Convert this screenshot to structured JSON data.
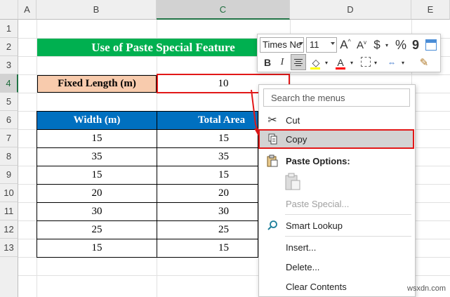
{
  "columns": [
    "A",
    "B",
    "C",
    "D",
    "E"
  ],
  "rows": [
    "1",
    "2",
    "3",
    "4",
    "5",
    "6",
    "7",
    "8",
    "9",
    "10",
    "11",
    "12",
    "13"
  ],
  "title": "Use of Paste Special Feature",
  "fixed_label": "Fixed Length (m)",
  "fixed_value": "10",
  "table": {
    "headers": [
      "Width (m)",
      "Total Area"
    ],
    "rows": [
      [
        "15",
        "15"
      ],
      [
        "35",
        "35"
      ],
      [
        "15",
        "15"
      ],
      [
        "20",
        "20"
      ],
      [
        "30",
        "30"
      ],
      [
        "25",
        "25"
      ],
      [
        "15",
        "15"
      ]
    ]
  },
  "mini_toolbar": {
    "font_name": "Times Ne",
    "font_size": "11",
    "increase_font": "A",
    "decrease_font": "A",
    "currency": "$",
    "percent": "%",
    "comma": "9",
    "bold": "B",
    "italic": "I",
    "font_color_letter": "A"
  },
  "context_menu": {
    "search_placeholder": "Search the menus",
    "cut": "Cut",
    "copy": "Copy",
    "paste_options": "Paste Options:",
    "paste_special": "Paste Special...",
    "smart_lookup": "Smart Lookup",
    "insert": "Insert...",
    "delete": "Delete...",
    "clear_contents": "Clear Contents"
  },
  "watermark": "wsxdn.com",
  "colors": {
    "title_bg": "#00b050",
    "label_bg": "#f8cbad",
    "header_bg": "#0070c0",
    "highlight_red": "#e21818",
    "excel_green": "#217346"
  }
}
